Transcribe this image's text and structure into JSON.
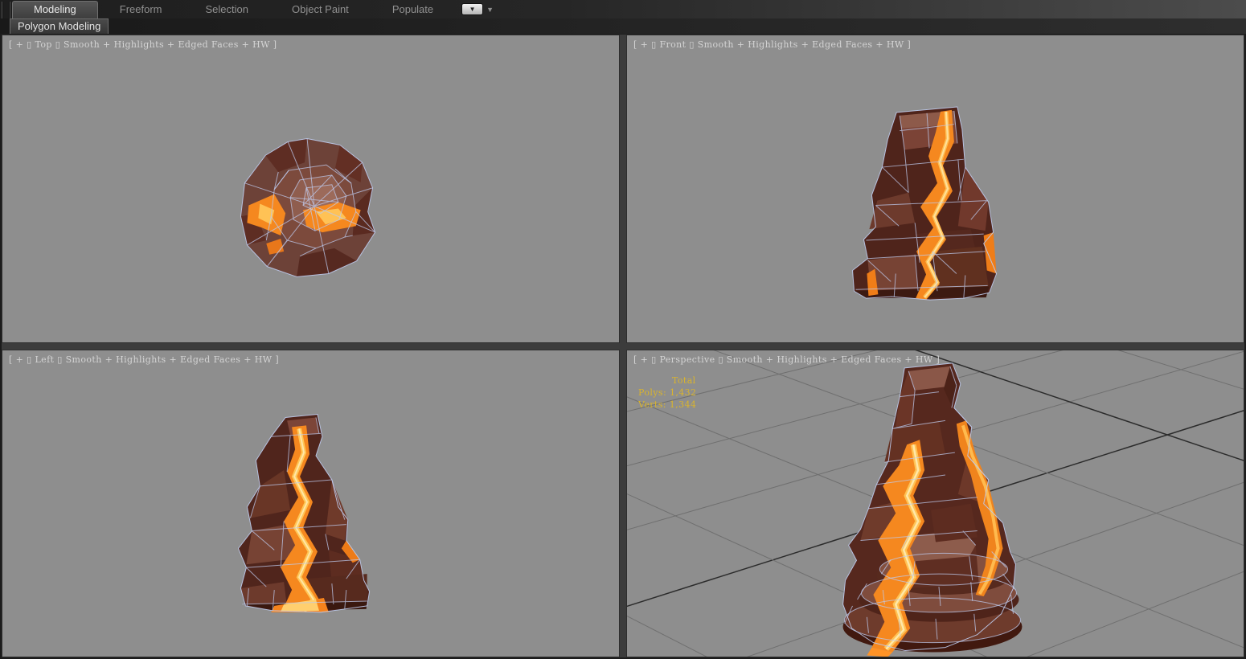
{
  "ribbon": {
    "tabs": [
      {
        "label": "Modeling",
        "active": true
      },
      {
        "label": "Freeform",
        "active": false
      },
      {
        "label": "Selection",
        "active": false
      },
      {
        "label": "Object Paint",
        "active": false
      },
      {
        "label": "Populate",
        "active": false
      }
    ],
    "panel_tab_label": "Polygon Modeling"
  },
  "viewports": {
    "top": {
      "label": "[ + ▯ Top ▯ Smooth + Highlights + Edged Faces + HW ]"
    },
    "front": {
      "label": "[ + ▯ Front ▯ Smooth + Highlights + Edged Faces + HW ]"
    },
    "left": {
      "label": "[ + ▯ Left ▯ Smooth + Highlights + Edged Faces + HW ]"
    },
    "perspective": {
      "label": "[ + ▯ Perspective ▯ Smooth + Highlights + Edged Faces + HW ]",
      "stats": {
        "title": "Total",
        "polys_label": "Polys:",
        "polys_value": "1,432",
        "verts_label": "Verts:",
        "verts_value": "1,344"
      }
    }
  },
  "colors": {
    "viewport_bg": "#8e8e8e",
    "stats_text": "#d9b42e",
    "wireframe": "#bdcaec",
    "rock_dark": "#4f241b",
    "rock_mid": "#6d4238",
    "lava": "#f5881f",
    "lava_bright": "#ffc255",
    "grid_line": "#6f6f6f",
    "grid_line_major": "#2b2b2b"
  }
}
